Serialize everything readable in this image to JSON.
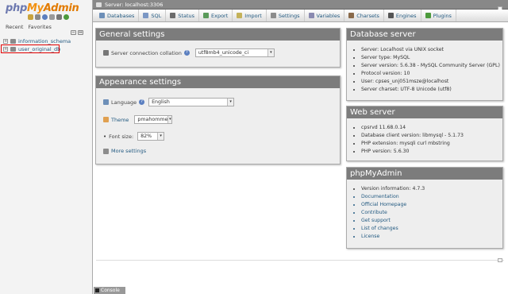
{
  "sidebar": {
    "logo": {
      "php": "php",
      "my": "My",
      "admin": "Admin"
    },
    "recent_label": "Recent",
    "favorites_label": "Favorites",
    "collapse_symbol": "−",
    "expand_symbol": "+",
    "databases": [
      {
        "name": "information_schema"
      },
      {
        "name": "user_original_db"
      }
    ]
  },
  "serverbar": {
    "title": "Server: localhost:3306"
  },
  "topmenu": {
    "tabs": [
      {
        "label": "Databases",
        "icon": "database-icon",
        "color": "#6d8fb8"
      },
      {
        "label": "SQL",
        "icon": "sql-icon",
        "color": "#7b97c4"
      },
      {
        "label": "Status",
        "icon": "status-icon",
        "color": "#6b6b6b"
      },
      {
        "label": "Export",
        "icon": "export-icon",
        "color": "#5a9a5a"
      },
      {
        "label": "Import",
        "icon": "import-icon",
        "color": "#c4b25a"
      },
      {
        "label": "Settings",
        "icon": "settings-icon",
        "color": "#8c8c8c"
      },
      {
        "label": "Variables",
        "icon": "variables-icon",
        "color": "#8a8ab0"
      },
      {
        "label": "Charsets",
        "icon": "charsets-icon",
        "color": "#8a6a4a"
      },
      {
        "label": "Engines",
        "icon": "engines-icon",
        "color": "#555"
      },
      {
        "label": "Plugins",
        "icon": "plugins-icon",
        "color": "#4c9a3c"
      }
    ]
  },
  "general_settings": {
    "title": "General settings",
    "collation_label": "Server connection collation",
    "collation_value": "utf8mb4_unicode_ci"
  },
  "appearance_settings": {
    "title": "Appearance settings",
    "language_label": "Language",
    "language_value": "English",
    "theme_label": "Theme",
    "theme_value": "pmahomme",
    "fontsize_label": "Font size:",
    "fontsize_value": "82%",
    "more_settings": "More settings"
  },
  "database_server": {
    "title": "Database server",
    "items": [
      "Server: Localhost via UNIX socket",
      "Server type: MySQL",
      "Server version: 5.6.38 - MySQL Community Server (GPL)",
      "Protocol version: 10",
      "User: cpses_unj051msze@localhost",
      "Server charset: UTF-8 Unicode (utf8)"
    ]
  },
  "web_server": {
    "title": "Web server",
    "items": [
      "cpsrvd 11.68.0.14",
      "Database client version: libmysql - 5.1.73",
      "PHP extension: mysqli  curl  mbstring",
      "PHP version: 5.6.30"
    ]
  },
  "phpmyadmin": {
    "title": "phpMyAdmin",
    "items": [
      {
        "label": "Version information: 4.7.3",
        "link": false
      },
      {
        "label": "Documentation",
        "link": true
      },
      {
        "label": "Official Homepage",
        "link": true
      },
      {
        "label": "Contribute",
        "link": true
      },
      {
        "label": "Get support",
        "link": true
      },
      {
        "label": "List of changes",
        "link": true
      },
      {
        "label": "License",
        "link": true
      }
    ]
  },
  "console": {
    "label": "Console"
  },
  "dropdown_arrow": "▾",
  "help_symbol": "?",
  "colors": {
    "accent": "#235a81",
    "header": "#7c7c7c",
    "highlight": "#e00000"
  }
}
